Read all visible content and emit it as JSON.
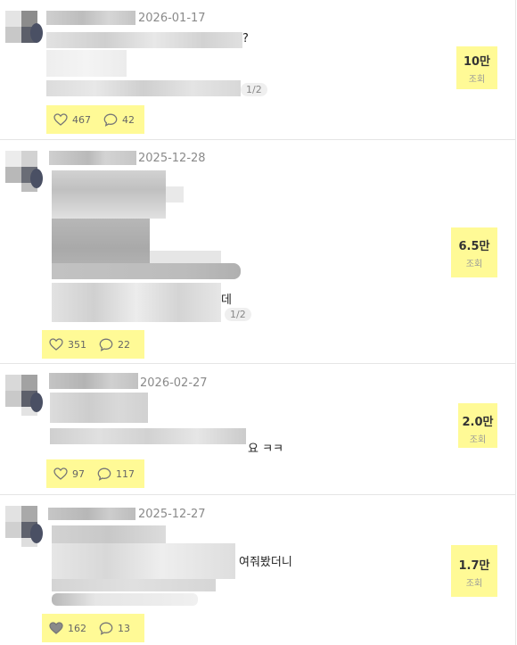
{
  "posts": [
    {
      "date": "2026-01-17",
      "title_fragment": "?",
      "page_indicator": "1/2",
      "likes": "467",
      "comments": "42",
      "liked": false,
      "views_value": "10만",
      "views_label": "조회"
    },
    {
      "date": "2025-12-28",
      "title_fragment": "",
      "body_fragment": "데",
      "page_indicator": "1/2",
      "likes": "351",
      "comments": "22",
      "liked": false,
      "views_value": "6.5만",
      "views_label": "조회"
    },
    {
      "date": "2026-02-27",
      "body_fragment": "요 ㅋㅋ",
      "likes": "97",
      "comments": "117",
      "liked": false,
      "views_value": "2.0만",
      "views_label": "조회"
    },
    {
      "date": "2025-12-27",
      "body_fragment": "여줘봤더니",
      "likes": "162",
      "comments": "13",
      "liked": true,
      "views_value": "1.7만",
      "views_label": "조회"
    }
  ]
}
